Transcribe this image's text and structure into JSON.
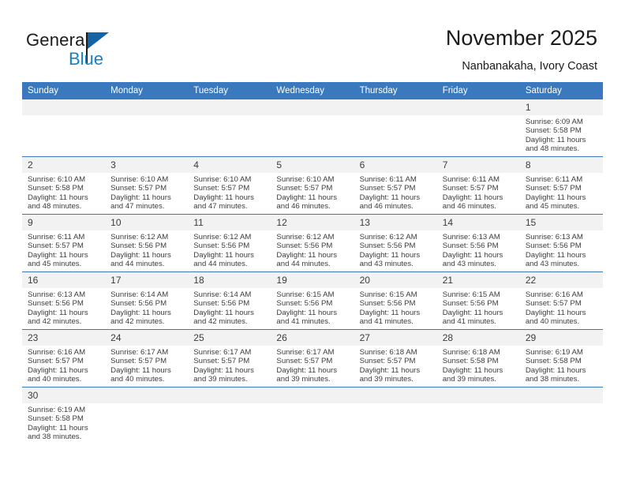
{
  "brand": {
    "name_top": "General",
    "name_bottom": "Blue",
    "accent_color": "#1a7fc1"
  },
  "header": {
    "title": "November 2025",
    "subtitle": "Nanbanakaha, Ivory Coast",
    "header_bg": "#3a79bd"
  },
  "calendar": {
    "weekdays": [
      "Sunday",
      "Monday",
      "Tuesday",
      "Wednesday",
      "Thursday",
      "Friday",
      "Saturday"
    ],
    "labels": {
      "sunrise": "Sunrise:",
      "sunset": "Sunset:",
      "daylight": "Daylight:"
    },
    "weeks": [
      [
        {
          "day": "",
          "empty": true
        },
        {
          "day": "",
          "empty": true
        },
        {
          "day": "",
          "empty": true
        },
        {
          "day": "",
          "empty": true
        },
        {
          "day": "",
          "empty": true
        },
        {
          "day": "",
          "empty": true
        },
        {
          "day": "1",
          "sunrise": "Sunrise: 6:09 AM",
          "sunset": "Sunset: 5:58 PM",
          "daylight": "Daylight: 11 hours and 48 minutes."
        }
      ],
      [
        {
          "day": "2",
          "sunrise": "Sunrise: 6:10 AM",
          "sunset": "Sunset: 5:58 PM",
          "daylight": "Daylight: 11 hours and 48 minutes."
        },
        {
          "day": "3",
          "sunrise": "Sunrise: 6:10 AM",
          "sunset": "Sunset: 5:57 PM",
          "daylight": "Daylight: 11 hours and 47 minutes."
        },
        {
          "day": "4",
          "sunrise": "Sunrise: 6:10 AM",
          "sunset": "Sunset: 5:57 PM",
          "daylight": "Daylight: 11 hours and 47 minutes."
        },
        {
          "day": "5",
          "sunrise": "Sunrise: 6:10 AM",
          "sunset": "Sunset: 5:57 PM",
          "daylight": "Daylight: 11 hours and 46 minutes."
        },
        {
          "day": "6",
          "sunrise": "Sunrise: 6:11 AM",
          "sunset": "Sunset: 5:57 PM",
          "daylight": "Daylight: 11 hours and 46 minutes."
        },
        {
          "day": "7",
          "sunrise": "Sunrise: 6:11 AM",
          "sunset": "Sunset: 5:57 PM",
          "daylight": "Daylight: 11 hours and 46 minutes."
        },
        {
          "day": "8",
          "sunrise": "Sunrise: 6:11 AM",
          "sunset": "Sunset: 5:57 PM",
          "daylight": "Daylight: 11 hours and 45 minutes."
        }
      ],
      [
        {
          "day": "9",
          "sunrise": "Sunrise: 6:11 AM",
          "sunset": "Sunset: 5:57 PM",
          "daylight": "Daylight: 11 hours and 45 minutes."
        },
        {
          "day": "10",
          "sunrise": "Sunrise: 6:12 AM",
          "sunset": "Sunset: 5:56 PM",
          "daylight": "Daylight: 11 hours and 44 minutes."
        },
        {
          "day": "11",
          "sunrise": "Sunrise: 6:12 AM",
          "sunset": "Sunset: 5:56 PM",
          "daylight": "Daylight: 11 hours and 44 minutes."
        },
        {
          "day": "12",
          "sunrise": "Sunrise: 6:12 AM",
          "sunset": "Sunset: 5:56 PM",
          "daylight": "Daylight: 11 hours and 44 minutes."
        },
        {
          "day": "13",
          "sunrise": "Sunrise: 6:12 AM",
          "sunset": "Sunset: 5:56 PM",
          "daylight": "Daylight: 11 hours and 43 minutes."
        },
        {
          "day": "14",
          "sunrise": "Sunrise: 6:13 AM",
          "sunset": "Sunset: 5:56 PM",
          "daylight": "Daylight: 11 hours and 43 minutes."
        },
        {
          "day": "15",
          "sunrise": "Sunrise: 6:13 AM",
          "sunset": "Sunset: 5:56 PM",
          "daylight": "Daylight: 11 hours and 43 minutes."
        }
      ],
      [
        {
          "day": "16",
          "sunrise": "Sunrise: 6:13 AM",
          "sunset": "Sunset: 5:56 PM",
          "daylight": "Daylight: 11 hours and 42 minutes."
        },
        {
          "day": "17",
          "sunrise": "Sunrise: 6:14 AM",
          "sunset": "Sunset: 5:56 PM",
          "daylight": "Daylight: 11 hours and 42 minutes."
        },
        {
          "day": "18",
          "sunrise": "Sunrise: 6:14 AM",
          "sunset": "Sunset: 5:56 PM",
          "daylight": "Daylight: 11 hours and 42 minutes."
        },
        {
          "day": "19",
          "sunrise": "Sunrise: 6:15 AM",
          "sunset": "Sunset: 5:56 PM",
          "daylight": "Daylight: 11 hours and 41 minutes."
        },
        {
          "day": "20",
          "sunrise": "Sunrise: 6:15 AM",
          "sunset": "Sunset: 5:56 PM",
          "daylight": "Daylight: 11 hours and 41 minutes."
        },
        {
          "day": "21",
          "sunrise": "Sunrise: 6:15 AM",
          "sunset": "Sunset: 5:56 PM",
          "daylight": "Daylight: 11 hours and 41 minutes."
        },
        {
          "day": "22",
          "sunrise": "Sunrise: 6:16 AM",
          "sunset": "Sunset: 5:57 PM",
          "daylight": "Daylight: 11 hours and 40 minutes."
        }
      ],
      [
        {
          "day": "23",
          "sunrise": "Sunrise: 6:16 AM",
          "sunset": "Sunset: 5:57 PM",
          "daylight": "Daylight: 11 hours and 40 minutes."
        },
        {
          "day": "24",
          "sunrise": "Sunrise: 6:17 AM",
          "sunset": "Sunset: 5:57 PM",
          "daylight": "Daylight: 11 hours and 40 minutes."
        },
        {
          "day": "25",
          "sunrise": "Sunrise: 6:17 AM",
          "sunset": "Sunset: 5:57 PM",
          "daylight": "Daylight: 11 hours and 39 minutes."
        },
        {
          "day": "26",
          "sunrise": "Sunrise: 6:17 AM",
          "sunset": "Sunset: 5:57 PM",
          "daylight": "Daylight: 11 hours and 39 minutes."
        },
        {
          "day": "27",
          "sunrise": "Sunrise: 6:18 AM",
          "sunset": "Sunset: 5:57 PM",
          "daylight": "Daylight: 11 hours and 39 minutes."
        },
        {
          "day": "28",
          "sunrise": "Sunrise: 6:18 AM",
          "sunset": "Sunset: 5:58 PM",
          "daylight": "Daylight: 11 hours and 39 minutes."
        },
        {
          "day": "29",
          "sunrise": "Sunrise: 6:19 AM",
          "sunset": "Sunset: 5:58 PM",
          "daylight": "Daylight: 11 hours and 38 minutes."
        }
      ],
      [
        {
          "day": "30",
          "sunrise": "Sunrise: 6:19 AM",
          "sunset": "Sunset: 5:58 PM",
          "daylight": "Daylight: 11 hours and 38 minutes."
        },
        {
          "day": "",
          "empty": true
        },
        {
          "day": "",
          "empty": true
        },
        {
          "day": "",
          "empty": true
        },
        {
          "day": "",
          "empty": true
        },
        {
          "day": "",
          "empty": true
        },
        {
          "day": "",
          "empty": true
        }
      ]
    ]
  }
}
